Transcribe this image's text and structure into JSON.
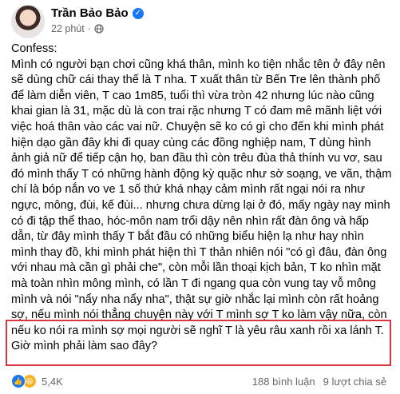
{
  "author": {
    "name": "Trần Bảo Bảo",
    "time": "22 phút",
    "separator": "·"
  },
  "post": {
    "heading": "Confess:",
    "body": "Mình có người bạn chơi cũng khá thân, mình ko tiện nhắc tên ở đây nên sẽ dùng chữ cái thay thế là T nha. T xuất thân từ Bến Tre lên thành phố để làm diễn viên, T cao 1m85, tuổi thì vừa tròn 42 nhưng lúc nào cũng khai gian là 31, mặc dù là con trai rặc nhưng T có đam mê mãnh liệt với việc hoá thân vào các vai nữ. Chuyện sẽ ko có gì cho đến khi mình phát hiện dạo gần đây khi đi quay cùng các đồng nghiệp nam, T dùng hình ảnh giả nữ để tiếp cận họ, ban đầu thì còn trêu đùa thả thính vu vơ, sau đó mình thấy T có những hành động kỳ quặc như sờ soạng, ve vãn, thậm chí là bóp nắn vo ve 1 số thứ khá nhạy cảm mình rất ngại nói ra như ngực, mông, đùi, kế đùi... nhưng chưa dừng lại ở đó, mấy ngày nay mình có đi tập thể thao, hóc-môn nam trổi dậy nên nhìn rất đàn ông và hấp dẫn, từ đây mình thấy T bắt đầu có những biểu hiện lạ như hay nhìn mình thay đồ, khi mình phát hiện thì T thản nhiên nói \"có gì đâu, đàn ông với nhau mà cần gì phải che\", còn mỗi lần thoại kịch bản, T ko nhìn mặt mà toàn nhìn mông mình, có lần T đi ngang qua còn vung tay vỗ mông mình và nói \"nẩy nha nẩy nha\", thật sự giờ nhắc lại mình còn rất hoảng sợ, nếu mình nói thẳng chuyện này với T mình sợ T ko làm vậy nữa, còn nếu ko nói ra mình sợ mọi người sẽ nghĩ T là yêu râu xanh rồi xa lánh T. Giờ mình phải làm sao đây?"
  },
  "footer": {
    "reactions": "5,4K",
    "comments": "188 bình luận",
    "shares": "9 lượt chia sẻ"
  },
  "icons": {
    "verified": "verified-badge-icon",
    "privacy": "globe-icon",
    "like": "like-icon",
    "haha": "haha-icon"
  },
  "colors": {
    "highlight": "#d9363e",
    "verified": "#1877f2",
    "meta": "#65676b"
  }
}
